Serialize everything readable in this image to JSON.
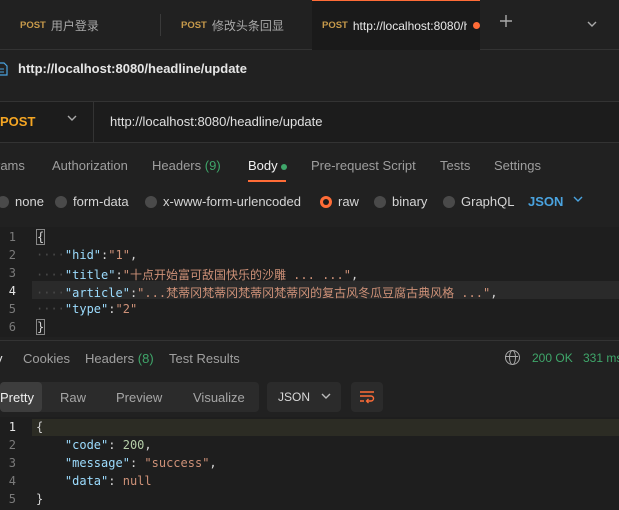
{
  "tabs": [
    {
      "method": "POST",
      "label": "用户登录"
    },
    {
      "method": "POST",
      "label": "修改头条回显"
    },
    {
      "method": "POST",
      "label": "http://localhost:8080/h"
    }
  ],
  "request": {
    "title": "http://localhost:8080/headline/update",
    "method": "POST",
    "url": "http://localhost:8080/headline/update"
  },
  "request_tabs": {
    "params": "rams",
    "authorization": "Authorization",
    "headers": "Headers",
    "headers_count": "(9)",
    "body": "Body",
    "prerequest": "Pre-request Script",
    "tests": "Tests",
    "settings": "Settings"
  },
  "body_types": {
    "none": "none",
    "form_data": "form-data",
    "urlencoded": "x-www-form-urlencoded",
    "raw": "raw",
    "binary": "binary",
    "graphql": "GraphQL",
    "lang": "JSON"
  },
  "editor": {
    "line_numbers": [
      "1",
      "2",
      "3",
      "4",
      "5",
      "6"
    ],
    "open": "{",
    "close": "}",
    "hid_key": "\"hid\"",
    "hid_val": "\"1\"",
    "title_key": "\"title\"",
    "title_val": "\"十点开始富可敌国快乐的沙雕 ... ...\"",
    "article_key": "\"article\"",
    "article_val": "\"...梵蒂冈梵蒂冈梵蒂冈梵蒂冈的复古风冬瓜豆腐古典风格 ...\"",
    "type_key": "\"type\"",
    "type_val": "\"2\""
  },
  "response_tabs": {
    "body": "y",
    "cookies": "Cookies",
    "headers": "Headers",
    "headers_count": "(8)",
    "test_results": "Test Results"
  },
  "response_status": {
    "status": "200 OK",
    "time": "331 ms"
  },
  "view_modes": {
    "pretty": "Pretty",
    "raw": "Raw",
    "preview": "Preview",
    "visualize": "Visualize",
    "format": "JSON"
  },
  "response_body": {
    "line_numbers": [
      "1",
      "2",
      "3",
      "4",
      "5"
    ],
    "open": "{",
    "close": "}",
    "code_key": "\"code\"",
    "code_val": "200",
    "message_key": "\"message\"",
    "message_val": "\"success\"",
    "data_key": "\"data\"",
    "data_val": "null"
  },
  "colors": {
    "accent": "#ff6c37",
    "success": "#3fa66a",
    "link": "#4aa3df",
    "method_post": "#f5a623"
  }
}
